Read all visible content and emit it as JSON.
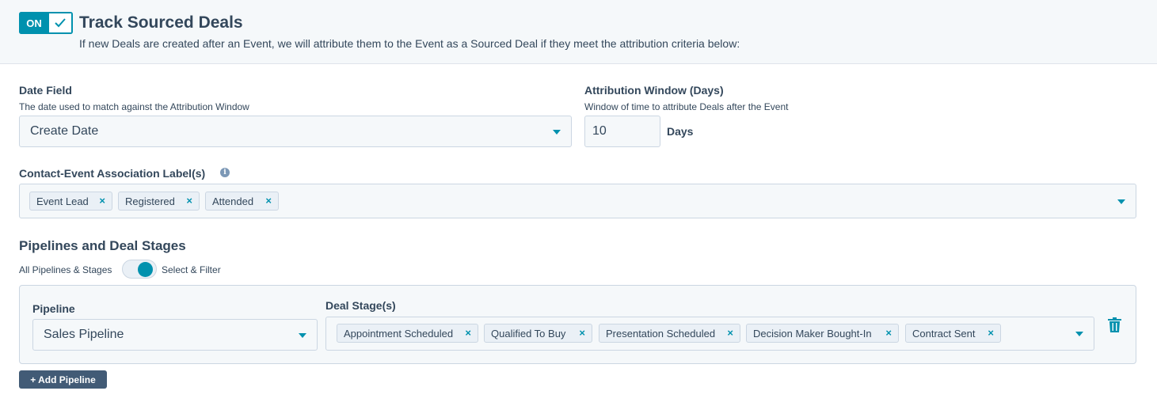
{
  "header": {
    "toggle_label": "ON",
    "title": "Track Sourced Deals",
    "description": "If new Deals are created after an Event, we will attribute them to the Event as a Sourced Deal if they meet the attribution criteria below:"
  },
  "date_field": {
    "label": "Date Field",
    "help": "The date used to match against the Attribution Window",
    "value": "Create Date"
  },
  "attribution_window": {
    "label": "Attribution Window (Days)",
    "help": "Window of time to attribute Deals after the Event",
    "value": "10",
    "unit": "Days"
  },
  "association_labels": {
    "label": "Contact-Event Association Label(s)",
    "info_icon": "i",
    "tags": [
      "Event Lead",
      "Registered",
      "Attended"
    ],
    "remove_glyph": "×"
  },
  "pipelines": {
    "title": "Pipelines and Deal Stages",
    "switch_left_label": "All Pipelines & Stages",
    "switch_right_label": "Select & Filter",
    "switch_state": "select-filter",
    "pipeline_label": "Pipeline",
    "pipeline_value": "Sales Pipeline",
    "stages_label": "Deal Stage(s)",
    "stages": [
      "Appointment Scheduled",
      "Qualified To Buy",
      "Presentation Scheduled",
      "Decision Maker Bought-In",
      "Contract Sent"
    ],
    "add_button": "+ Add Pipeline"
  },
  "colors": {
    "accent": "#0091ae",
    "text": "#33475b",
    "button_dark": "#425b76"
  }
}
